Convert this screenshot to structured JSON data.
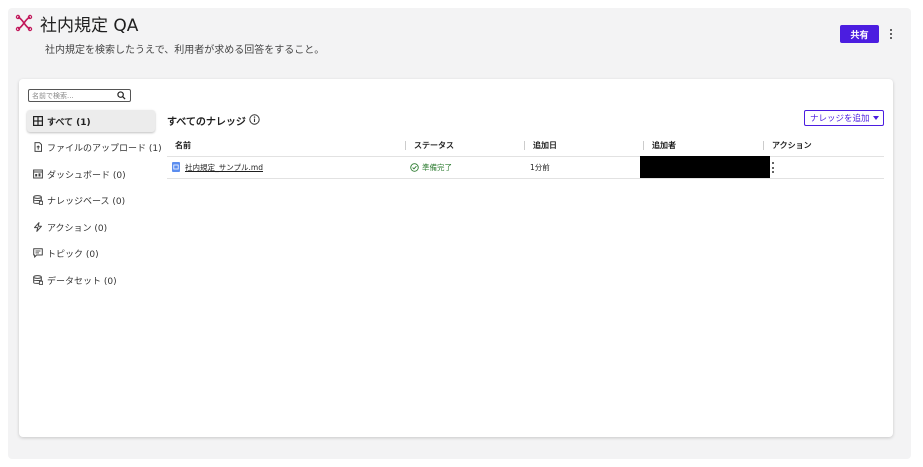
{
  "header": {
    "title": "社内規定 QA",
    "subtitle": "社内規定を検索したうえで、利用者が求める回答をすること。",
    "share_label": "共有"
  },
  "sidebar": {
    "search_placeholder": "名前で検索...",
    "items": [
      {
        "label": "すべて (1)",
        "icon": "grid-icon",
        "active": true
      },
      {
        "label": "ファイルのアップロード (1)",
        "icon": "file-upload-icon"
      },
      {
        "label": "ダッシュボード (0)",
        "icon": "dashboard-icon"
      },
      {
        "label": "ナレッジベース (0)",
        "icon": "knowledge-base-icon"
      },
      {
        "label": "アクション (0)",
        "icon": "lightning-icon"
      },
      {
        "label": "トピック (0)",
        "icon": "topic-icon"
      },
      {
        "label": "データセット (0)",
        "icon": "dataset-icon"
      }
    ]
  },
  "main": {
    "section_title": "すべてのナレッジ",
    "add_button_label": "ナレッジを追加",
    "table": {
      "columns": [
        "名前",
        "ステータス",
        "追加日",
        "追加者",
        "アクション"
      ],
      "rows": [
        {
          "name": "社内規定_サンプル.md",
          "status": "準備完了",
          "added_date": "1分前",
          "added_by": ""
        }
      ]
    }
  },
  "colors": {
    "accent": "#4b1de0",
    "status_ready": "#2e7d32",
    "logo": "#c2185b"
  }
}
